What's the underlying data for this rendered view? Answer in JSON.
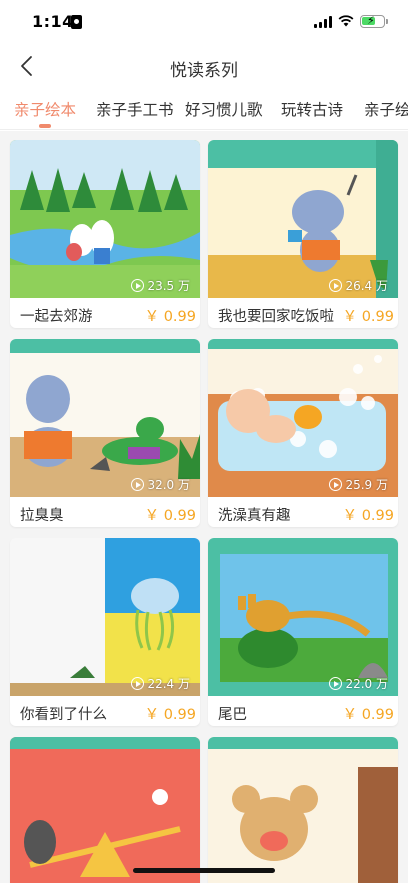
{
  "status_bar": {
    "time": "1:14"
  },
  "nav": {
    "title": "悦读系列"
  },
  "tabs": [
    {
      "label": "亲子绘本"
    },
    {
      "label": "亲子手工书"
    },
    {
      "label": "好习惯儿歌"
    },
    {
      "label": "玩转古诗"
    },
    {
      "label": "亲子绘"
    }
  ],
  "active_tab_color": "#f08a6c",
  "price_color": "#f5a623",
  "cards": [
    {
      "title": "一起去郊游",
      "price": "￥ 0.99",
      "plays": "23.5 万"
    },
    {
      "title": "我也要回家吃饭啦",
      "price": "￥ 0.99",
      "plays": "26.4 万"
    },
    {
      "title": "拉臭臭",
      "price": "￥ 0.99",
      "plays": "32.0 万"
    },
    {
      "title": "洗澡真有趣",
      "price": "￥ 0.99",
      "plays": "25.9 万"
    },
    {
      "title": "你看到了什么",
      "price": "￥ 0.99",
      "plays": "22.4 万"
    },
    {
      "title": "尾巴",
      "price": "￥ 0.99",
      "plays": "22.0 万"
    },
    {
      "title": "",
      "price": "",
      "plays": ""
    },
    {
      "title": "",
      "price": "",
      "plays": ""
    }
  ]
}
